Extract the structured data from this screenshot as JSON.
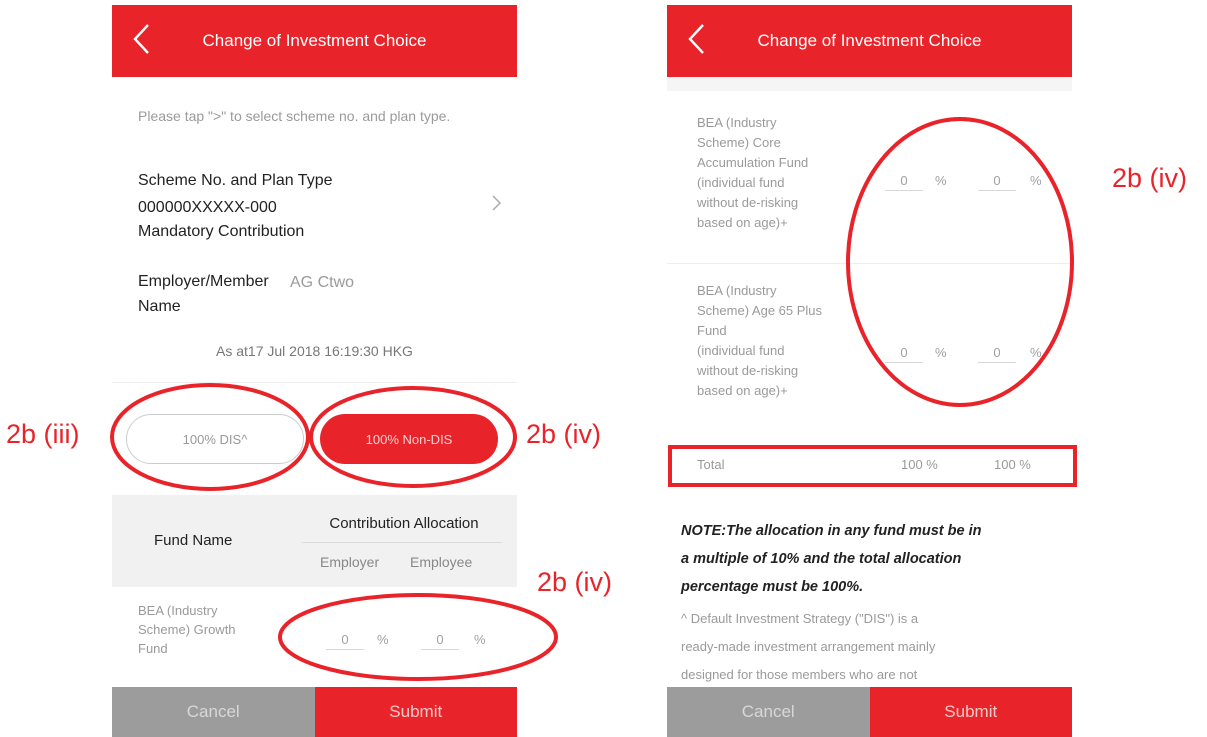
{
  "header": {
    "title": "Change of Investment Choice"
  },
  "left": {
    "instruction": "Please tap \">\" to select scheme no. and plan type.",
    "scheme_label": "Scheme No. and Plan Type",
    "scheme_no": "000000XXXXX-000",
    "plan_type": "Mandatory Contribution",
    "employer_label_line1": "Employer/Member",
    "employer_label_line2": "Name",
    "employer_value": "AG Ctwo",
    "as_at": "As at17 Jul 2018 16:19:30 HKG",
    "dis_button": "100% DIS^",
    "non_dis_button": "100% Non-DIS",
    "table": {
      "fund_name_header": "Fund Name",
      "allocation_header": "Contribution Allocation",
      "employer_header": "Employer",
      "employee_header": "Employee"
    },
    "fund": {
      "name_l1": "BEA (Industry",
      "name_l2": "Scheme) Growth",
      "name_l3": "Fund",
      "employer_value": "0",
      "employee_value": "0"
    },
    "cancel": "Cancel",
    "submit": "Submit"
  },
  "right": {
    "funds": [
      {
        "l1": "BEA (Industry",
        "l2": "Scheme) Core",
        "l3": "Accumulation Fund",
        "l4": "(individual fund",
        "l5": "without de-risking",
        "l6": "based on age)+",
        "employer_value": "0",
        "employee_value": "0"
      },
      {
        "l1": "BEA (Industry",
        "l2": "Scheme) Age 65 Plus",
        "l3": "Fund",
        "l4": "(individual fund",
        "l5": "without de-risking",
        "l6": "based on age)+",
        "employer_value": "0",
        "employee_value": "0"
      }
    ],
    "percent_sign": "%",
    "total_label": "Total",
    "total_employer": "100 %",
    "total_employee": "100 %",
    "note_l1": "NOTE:The allocation in any fund must be in",
    "note_l2": "a multiple of 10% and the total allocation",
    "note_l3": "percentage must be 100%.",
    "dis_l1": "^ Default Investment Strategy (\"DIS\") is a",
    "dis_l2": "ready-made investment arrangement mainly",
    "dis_l3": "designed for those members who are not",
    "cancel": "Cancel",
    "submit": "Submit"
  },
  "annotations": {
    "label_2b_iii": "2b (iii)",
    "label_2b_iv_buttons": "2b (iv)",
    "label_2b_iv_fund": "2b (iv)",
    "label_2b_iv_right": "2b (iv)"
  },
  "colors": {
    "brand_red": "#e8242a",
    "cancel_grey": "#9c9c9c",
    "annotation_red": "#e8242a"
  }
}
